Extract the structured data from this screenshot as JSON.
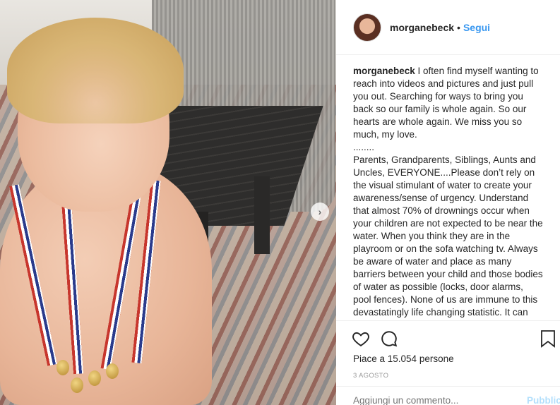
{
  "post": {
    "username": "morganebeck",
    "dot": "•",
    "follow_label": "Segui"
  },
  "caption": {
    "username": "morganebeck",
    "text": " I often find myself wanting to reach into videos and pictures and just pull you out. Searching for ways to bring you back so our family is whole again. So our hearts are whole again. We miss you so much, my love.\n........\nParents, Grandparents, Siblings, Aunts and Uncles, EVERYONE....Please don’t rely on the visual stimulant of water to create your awareness/sense of urgency. Understand that almost 70% of drownings occur when your children are not expected to be near the water. When you think they are in the playroom or on the sofa watching tv. Always be aware of water and place as many barriers between your child and those bodies of water as possible (locks, door alarms, pool fences). None of us are immune to this devastatingly life changing statistic. It can happen so fast and forever"
  },
  "engagement": {
    "likes_text": "Piace a 15.054 persone",
    "date": "3 AGOSTO"
  },
  "comment": {
    "placeholder": "Aggiungi un commento...",
    "publish_label": "Pubblica"
  },
  "icons": {
    "like": "heart-icon",
    "comment": "comment-icon",
    "save": "bookmark-icon",
    "next": "chevron-right-icon"
  },
  "colors": {
    "link": "#3897f0",
    "text": "#262626",
    "muted": "#999999",
    "border": "#efefef"
  }
}
